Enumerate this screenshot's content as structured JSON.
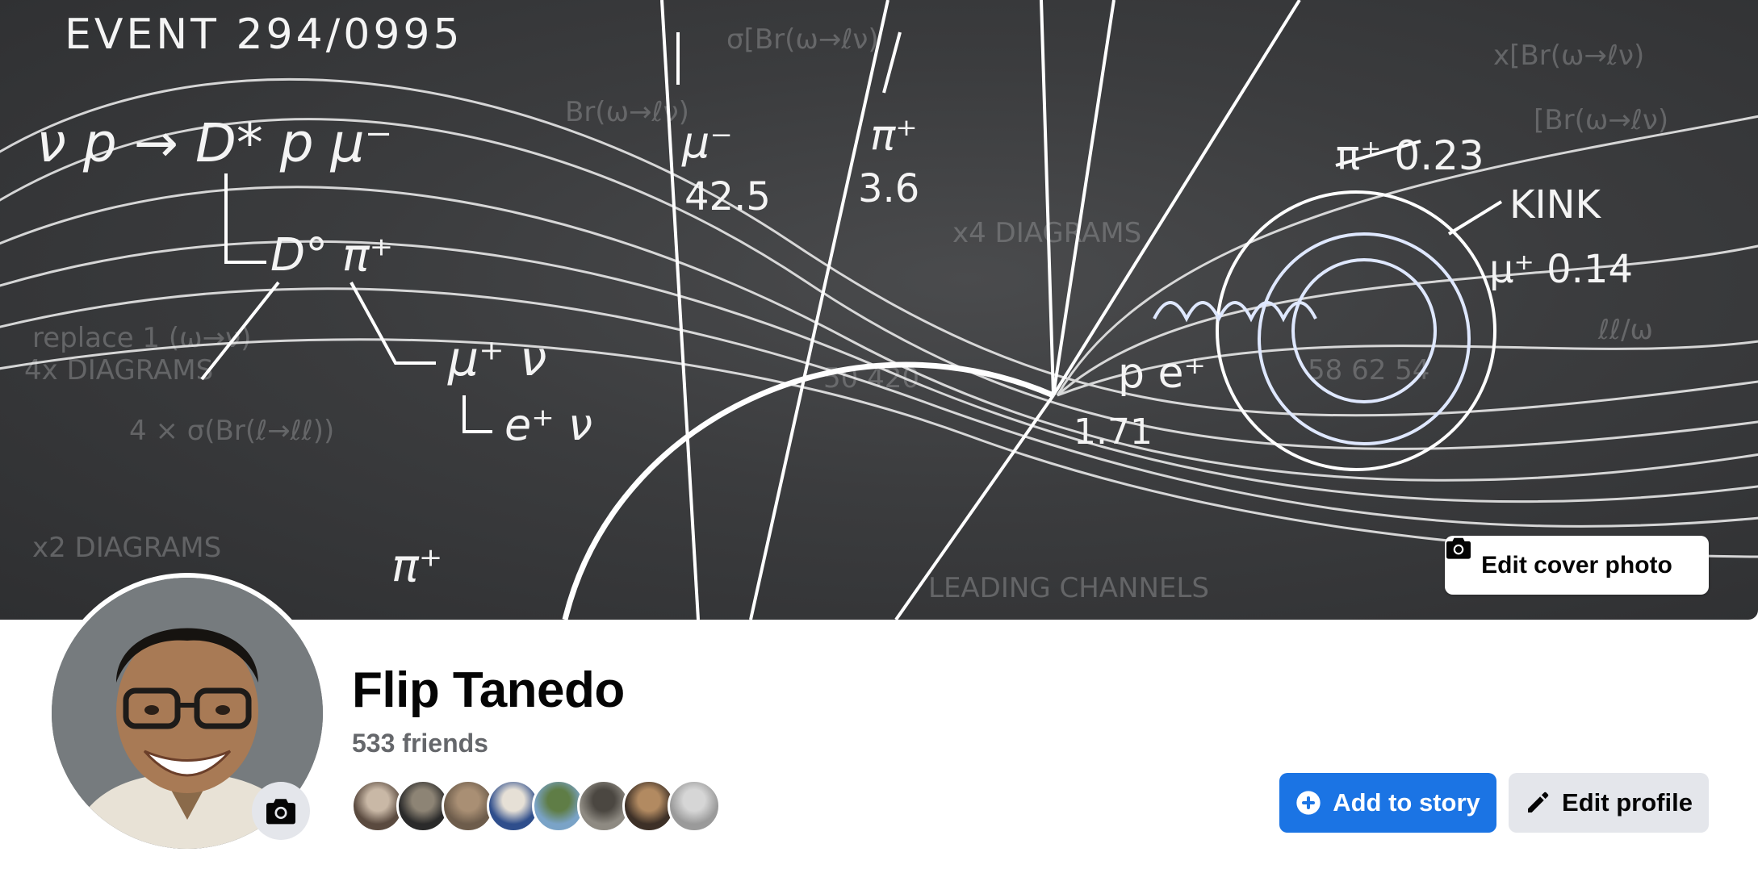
{
  "cover": {
    "edit_cover_label": "Edit cover photo",
    "chalkboard_text": {
      "event": "EVENT 294/0995",
      "reaction": "ν p → D* p μ⁻",
      "d0": "D° π⁺",
      "mu_nu": "μ⁺ ν",
      "e_nu": "e⁺ ν",
      "mu_minus": "μ⁻",
      "mu_minus_val": "42.5",
      "pi_plus": "π⁺",
      "pi_plus_val": "3.6",
      "pi_plus_right": "π⁺ 0.23",
      "kink": "KINK",
      "mu_plus_right": "μ⁺ 0.14",
      "pe": "p e⁺",
      "pe_val": "1.71",
      "pi_plus_bottom": "π⁺"
    }
  },
  "profile": {
    "name": "Flip Tanedo",
    "friends_count": "533 friends"
  },
  "friends": [
    {
      "color_a": "#5a4a3f",
      "color_b": "#c9b8a6"
    },
    {
      "color_a": "#2a2a2a",
      "color_b": "#8d8475"
    },
    {
      "color_a": "#6d5c4b",
      "color_b": "#a98f74"
    },
    {
      "color_a": "#2f4e8c",
      "color_b": "#e6e0d6"
    },
    {
      "color_a": "#7aa3c7",
      "color_b": "#5f7d46"
    },
    {
      "color_a": "#8e8a82",
      "color_b": "#4b4741"
    },
    {
      "color_a": "#3d3027",
      "color_b": "#b28a61"
    },
    {
      "color_a": "#9a9a9a",
      "color_b": "#d6d6d6"
    }
  ],
  "actions": {
    "add_to_story": "Add to story",
    "edit_profile": "Edit profile"
  },
  "colors": {
    "primary": "#1b74e4",
    "secondary_bg": "#e4e6eb",
    "muted_text": "#65676b"
  },
  "icons": {
    "camera": "camera-icon",
    "plus": "plus-circle-icon",
    "pencil": "pencil-icon"
  }
}
